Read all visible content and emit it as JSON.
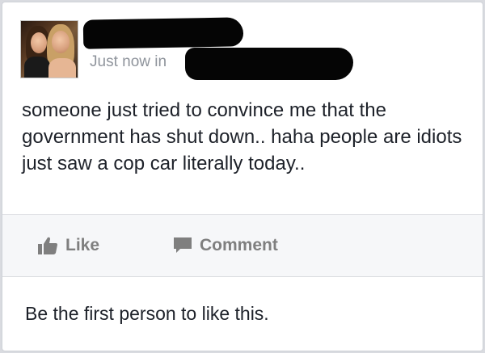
{
  "post": {
    "timestamp": "Just now in",
    "text": "someone just tried to convince me that the government has shut down.. haha people are idiots just saw a cop car literally today.."
  },
  "actions": {
    "like_label": "Like",
    "comment_label": "Comment"
  },
  "likes_summary": "Be the first person to like this.",
  "colors": {
    "action_gray": "#7f7f7f",
    "text": "#1d2129",
    "timestamp_gray": "#8f949c"
  }
}
